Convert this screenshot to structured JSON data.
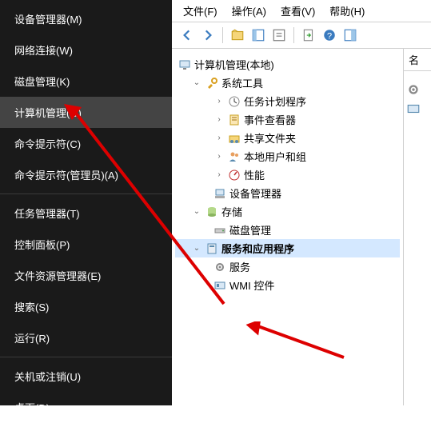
{
  "leftMenu": {
    "items": [
      {
        "label": "设备管理器(M)"
      },
      {
        "label": "网络连接(W)"
      },
      {
        "label": "磁盘管理(K)"
      },
      {
        "label": "计算机管理(G)",
        "highlighted": true
      },
      {
        "label": "命令提示符(C)"
      },
      {
        "label": "命令提示符(管理员)(A)"
      }
    ],
    "items2": [
      {
        "label": "任务管理器(T)"
      },
      {
        "label": "控制面板(P)"
      },
      {
        "label": "文件资源管理器(E)"
      },
      {
        "label": "搜索(S)"
      },
      {
        "label": "运行(R)"
      }
    ],
    "items3": [
      {
        "label": "关机或注销(U)"
      },
      {
        "label": "桌面(D)"
      }
    ]
  },
  "menubar": {
    "file": "文件(F)",
    "action": "操作(A)",
    "view": "查看(V)",
    "help": "帮助(H)"
  },
  "tree": {
    "root": "计算机管理(本地)",
    "systemTools": "系统工具",
    "taskScheduler": "任务计划程序",
    "eventViewer": "事件查看器",
    "sharedFolders": "共享文件夹",
    "localUsers": "本地用户和组",
    "performance": "性能",
    "deviceManager": "设备管理器",
    "storage": "存储",
    "diskManagement": "磁盘管理",
    "servicesApps": "服务和应用程序",
    "services": "服务",
    "wmi": "WMI 控件"
  },
  "rightCol": {
    "name": "名"
  }
}
